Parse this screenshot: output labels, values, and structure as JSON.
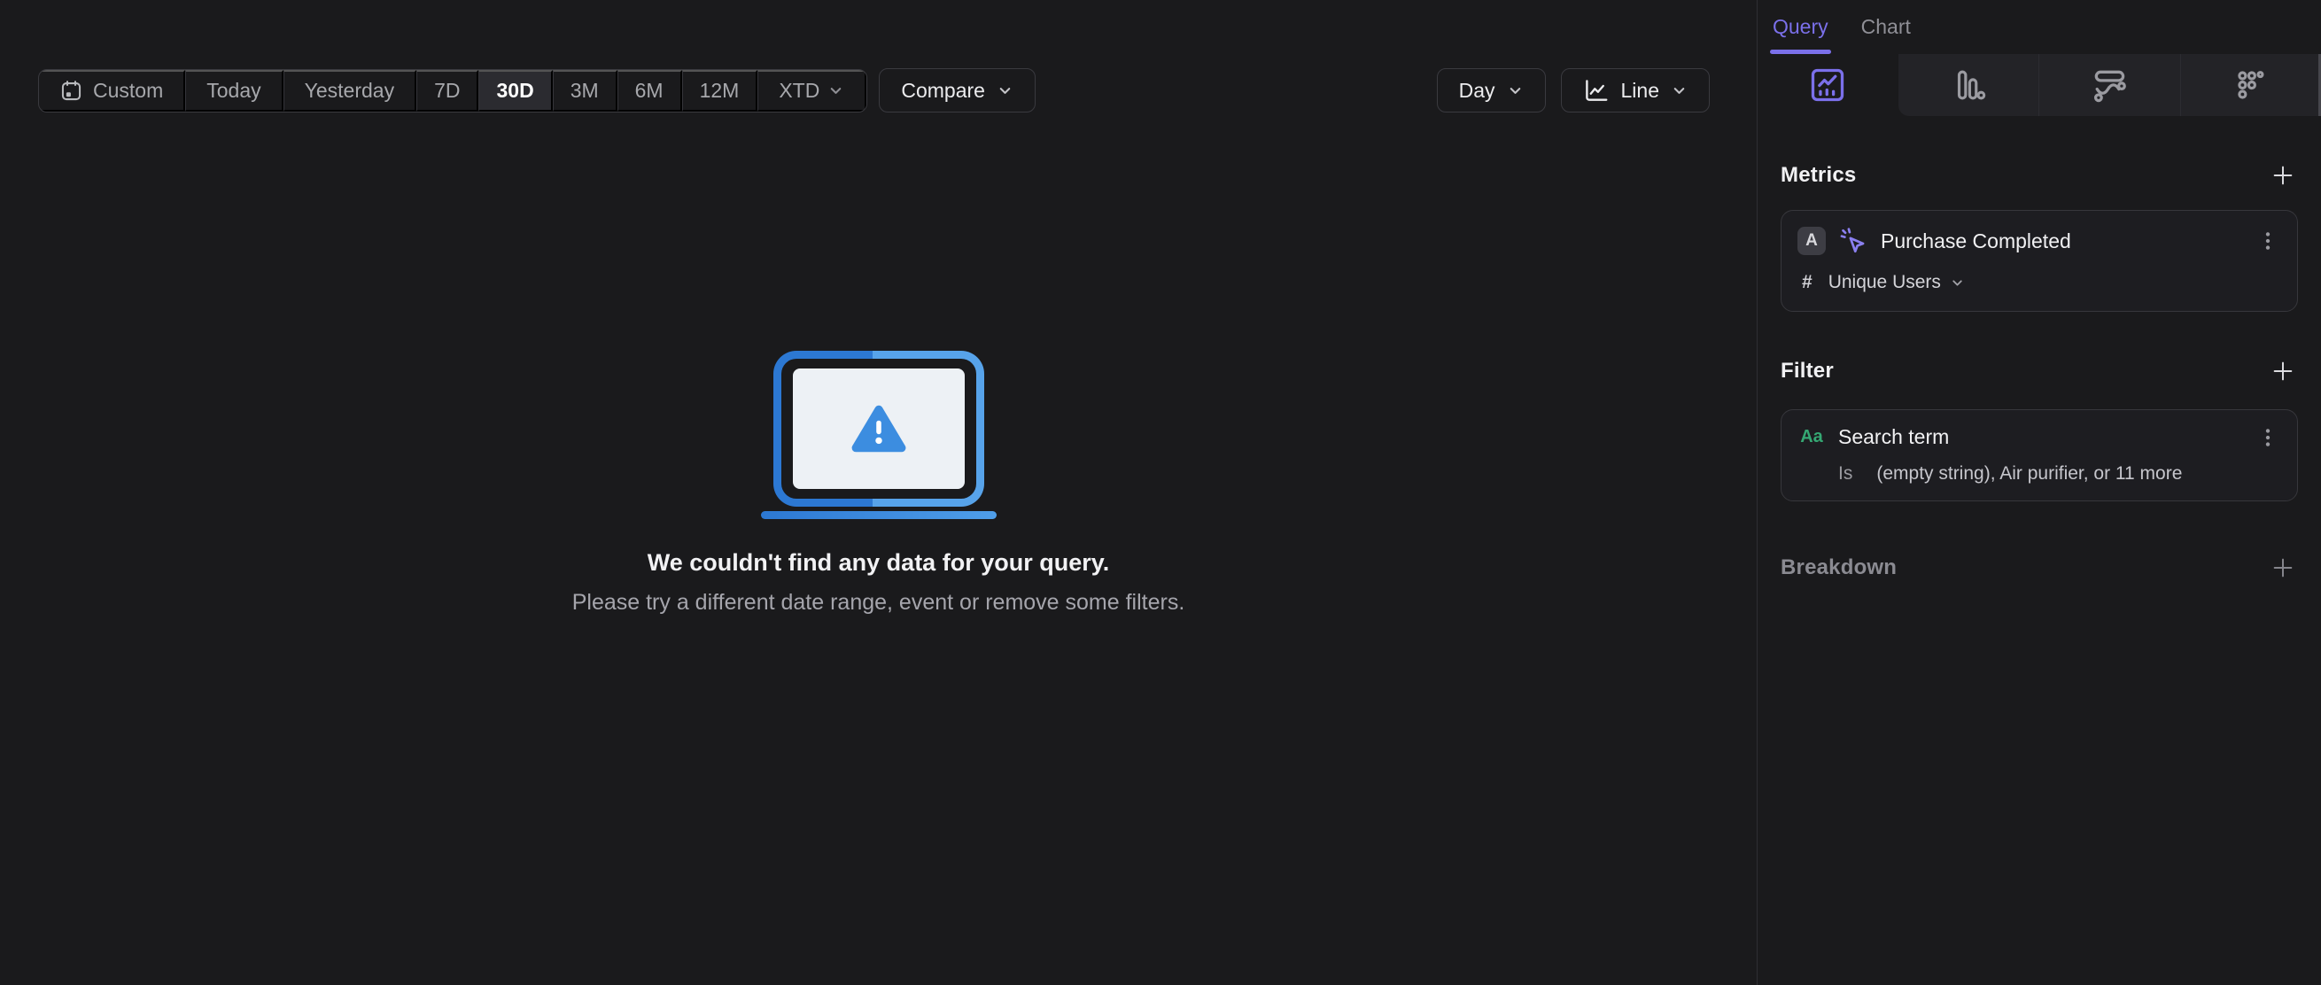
{
  "toolbar": {
    "ranges": [
      "Custom",
      "Today",
      "Yesterday",
      "7D",
      "30D",
      "3M",
      "6M",
      "12M",
      "XTD"
    ],
    "selected_range": "30D",
    "compare_label": "Compare",
    "interval_label": "Day",
    "chart_type_label": "Line"
  },
  "empty_state": {
    "title": "We couldn't find any data for your query.",
    "subtitle": "Please try a different date range, event or remove some filters."
  },
  "sidebar": {
    "tabs": {
      "query": "Query",
      "chart": "Chart"
    },
    "icon_tabs": [
      "insights",
      "funnels",
      "flows",
      "retention"
    ],
    "metrics": {
      "heading": "Metrics",
      "item": {
        "letter_badge": "A",
        "event_name": "Purchase Completed",
        "aggregation_symbol": "#",
        "aggregation": "Unique Users"
      }
    },
    "filter": {
      "heading": "Filter",
      "item": {
        "type_label": "Aa",
        "property_name": "Search term",
        "operator": "Is",
        "values_summary": "(empty string), Air purifier, or 11 more"
      }
    },
    "breakdown": {
      "heading": "Breakdown"
    }
  },
  "colors": {
    "background": "#1a1a1c",
    "accent_purple": "#7b70ea",
    "illustration_blue_dark": "#2c78d3",
    "illustration_blue_light": "#57a3ea",
    "warning_triangle_blue": "#3c8de0",
    "filter_type_green": "#35a873",
    "selected_segment_bg": "#2b2b30"
  }
}
